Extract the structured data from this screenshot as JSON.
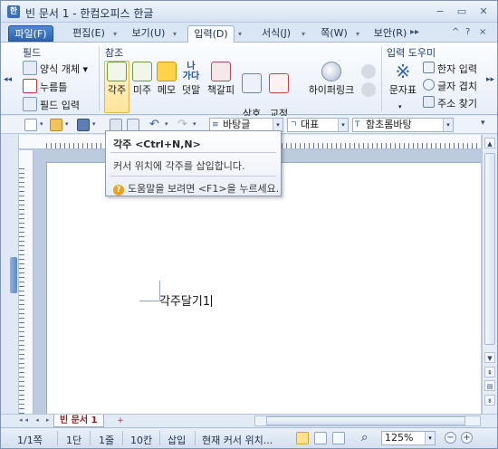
{
  "window": {
    "title": "빈 문서 1 - 한컴오피스 한글",
    "app_icon": "한",
    "minimize": "−",
    "restore": "▭",
    "close": "✕"
  },
  "menu": {
    "tabs": [
      {
        "label": "파일(F)"
      },
      {
        "label": "편집(E)"
      },
      {
        "label": "보기(U)"
      },
      {
        "label": "입력(D)"
      },
      {
        "label": "서식(J)"
      },
      {
        "label": "쪽(W)"
      },
      {
        "label": "보안(R)"
      }
    ],
    "more": "▸▸",
    "collapse": "^",
    "help": "?",
    "close": "×"
  },
  "ribbon": {
    "groups": {
      "field": {
        "label": "필드",
        "items": [
          "양식 개체 ▾",
          "누름틀",
          "필드 입력"
        ]
      },
      "reference": {
        "label": "참조",
        "items": [
          "각주",
          "미주",
          "메모",
          "덧말",
          "책갈피",
          "상호\n참조",
          "교정\n부호▾",
          "하이퍼링크"
        ]
      },
      "input_helper": {
        "label": "입력 도우미",
        "big": "문자표",
        "items": [
          "한자 입력",
          "글자 겹치",
          "주소 찾기"
        ]
      }
    },
    "nav_left": "◂◂",
    "nav_right": "▸▸",
    "icon_ruby_text": "가다",
    "icon_ruby_small": "나"
  },
  "toolbar": {
    "style_combo": "바탕글",
    "lang_combo": "대표",
    "font_combo": "함초롬바탕",
    "more": "▾"
  },
  "tooltip": {
    "title": "각주 <Ctrl+N,N>",
    "body": "커서 위치에 각주를 삽입합니다.",
    "help": "도움말을 보려면 <F1>을 누르세요.",
    "help_icon": "?"
  },
  "document": {
    "text": "각주달기1"
  },
  "doc_tabs": {
    "active": "빈 문서 1",
    "new": "+",
    "nav": "◂◂ ◂ ▸"
  },
  "status": {
    "page": "1/1쪽",
    "section": "1단",
    "line": "1줄",
    "column": "10칸",
    "mode": "삽입",
    "message": "현재 커서 위치...",
    "zoom": "125%",
    "zoom_minus": "−",
    "zoom_plus": "+"
  },
  "colors": {
    "accent": "#2f64ad",
    "ribbon_bg": "#e7eef8",
    "selected": "#ffe49a"
  }
}
